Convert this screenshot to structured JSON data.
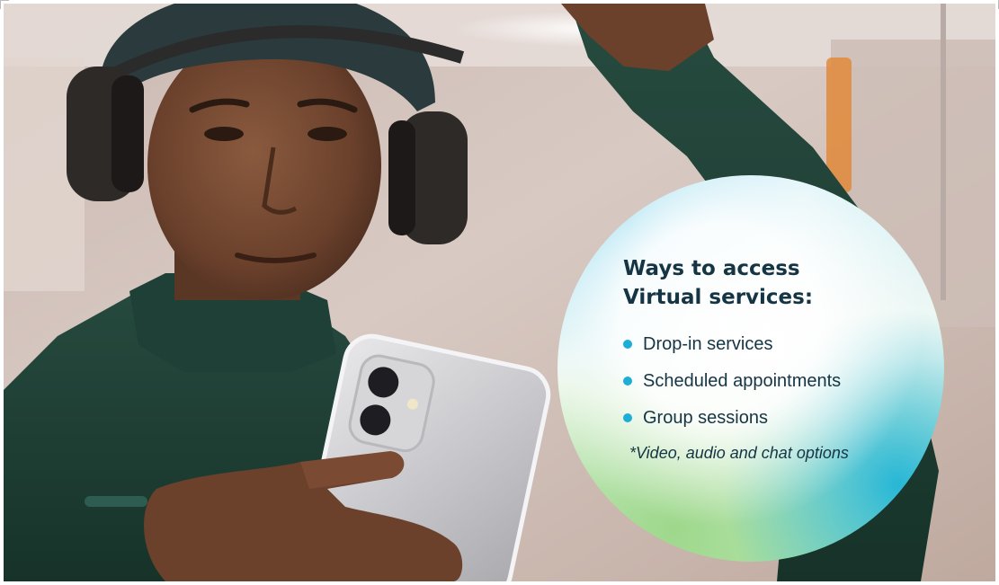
{
  "image": {
    "description_alt": "",
    "subjects": [
      "person-with-headphones",
      "smartphone"
    ]
  },
  "colors": {
    "heading_text": "#153544",
    "bullet_accent": "#1dadd6",
    "sweater": "#1f4036"
  },
  "callout": {
    "title_line_1": "Ways to access",
    "title_line_2": "Virtual services:",
    "items": [
      "Drop-in services",
      "Scheduled appointments",
      "Group sessions"
    ],
    "note": "*Video, audio and chat options"
  }
}
